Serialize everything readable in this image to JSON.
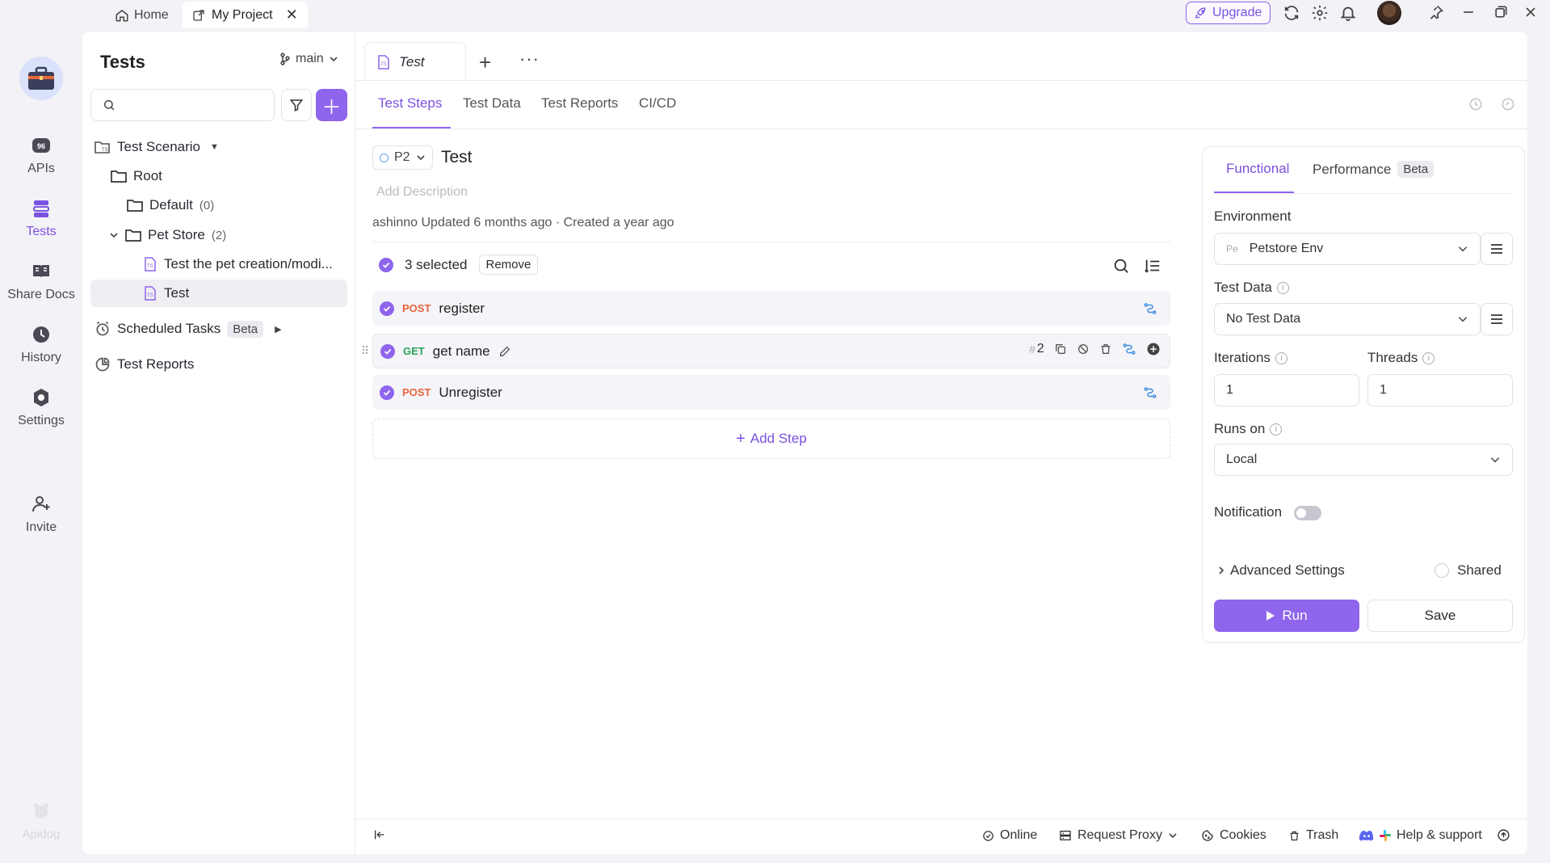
{
  "titlebar": {
    "home_tab": "Home",
    "project_tab": "My Project",
    "upgrade": "Upgrade"
  },
  "rail": {
    "items": [
      {
        "label": "APIs",
        "icon": "apis-icon"
      },
      {
        "label": "Tests",
        "icon": "tests-icon",
        "active": true
      },
      {
        "label": "Share Docs",
        "icon": "book-icon"
      },
      {
        "label": "History",
        "icon": "history-icon"
      },
      {
        "label": "Settings",
        "icon": "settings-icon"
      },
      {
        "label": "Invite",
        "icon": "invite-icon"
      }
    ],
    "brand": "Apidog"
  },
  "tree": {
    "title": "Tests",
    "branch": "main",
    "search_placeholder": "",
    "items": [
      {
        "label": "Test Scenario"
      },
      {
        "label": "Root"
      },
      {
        "label": "Default",
        "count": "(0)"
      },
      {
        "label": "Pet Store",
        "count": "(2)"
      },
      {
        "label": "Test the pet creation/modi..."
      },
      {
        "label": "Test"
      },
      {
        "label": "Scheduled Tasks",
        "badge": "Beta"
      },
      {
        "label": "Test Reports"
      }
    ]
  },
  "editor": {
    "tab_label": "Test",
    "subtabs": [
      "Test Steps",
      "Test Data",
      "Test Reports",
      "CI/CD"
    ],
    "priority": "P2",
    "case_title": "Test",
    "add_description": "Add Description",
    "meta": "ashinno Updated 6 months ago · Created a year ago",
    "selected_text": "3 selected",
    "remove_label": "Remove",
    "steps": [
      {
        "method": "POST",
        "name": "register"
      },
      {
        "method": "GET",
        "name": "get name",
        "index": "2"
      },
      {
        "method": "POST",
        "name": "Unregister"
      }
    ],
    "add_step": "Add Step"
  },
  "config": {
    "tabs": {
      "functional": "Functional",
      "performance": "Performance",
      "beta": "Beta"
    },
    "environment_label": "Environment",
    "environment_prefix": "Pe",
    "environment_value": "Petstore Env",
    "test_data_label": "Test Data",
    "test_data_value": "No Test Data",
    "iterations_label": "Iterations",
    "iterations_value": "1",
    "threads_label": "Threads",
    "threads_value": "1",
    "runs_on_label": "Runs on",
    "runs_on_value": "Local",
    "notification_label": "Notification",
    "notification_on": false,
    "advanced_label": "Advanced Settings",
    "shared_label": "Shared",
    "run_label": "Run",
    "save_label": "Save"
  },
  "footer": {
    "online": "Online",
    "proxy": "Request Proxy",
    "cookies": "Cookies",
    "trash": "Trash",
    "help": "Help & support"
  },
  "colors": {
    "accent": "#8e65ec",
    "post": "#e8633f",
    "get": "#27a35b"
  }
}
